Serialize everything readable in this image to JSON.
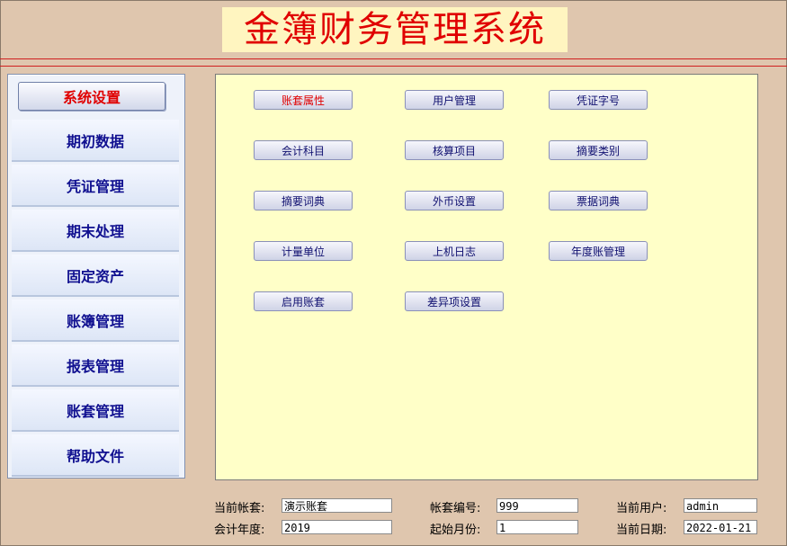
{
  "app": {
    "title": "金簿财务管理系统"
  },
  "sidebar": {
    "items": [
      {
        "label": "系统设置"
      },
      {
        "label": "期初数据"
      },
      {
        "label": "凭证管理"
      },
      {
        "label": "期末处理"
      },
      {
        "label": "固定资产"
      },
      {
        "label": "账簿管理"
      },
      {
        "label": "报表管理"
      },
      {
        "label": "账套管理"
      },
      {
        "label": "帮助文件"
      }
    ]
  },
  "main": {
    "buttons": [
      {
        "label": "账套属性"
      },
      {
        "label": "用户管理"
      },
      {
        "label": "凭证字号"
      },
      {
        "label": "会计科目"
      },
      {
        "label": "核算项目"
      },
      {
        "label": "摘要类别"
      },
      {
        "label": "摘要词典"
      },
      {
        "label": "外币设置"
      },
      {
        "label": "票据词典"
      },
      {
        "label": "计量单位"
      },
      {
        "label": "上机日志"
      },
      {
        "label": "年度账管理"
      },
      {
        "label": "启用账套"
      },
      {
        "label": "差异项设置"
      }
    ]
  },
  "status": {
    "current_book_label": "当前帐套:",
    "current_book": "演示账套",
    "book_no_label": "帐套编号:",
    "book_no": "999",
    "current_user_label": "当前用户:",
    "current_user": "admin",
    "fiscal_year_label": "会计年度:",
    "fiscal_year": "2019",
    "start_month_label": "起始月份:",
    "start_month": "1",
    "current_date_label": "当前日期:",
    "current_date": "2022-01-21"
  },
  "colors": {
    "title_red": "#e00000",
    "nav_blue": "#101090",
    "panel_yellow": "#ffffc8"
  }
}
